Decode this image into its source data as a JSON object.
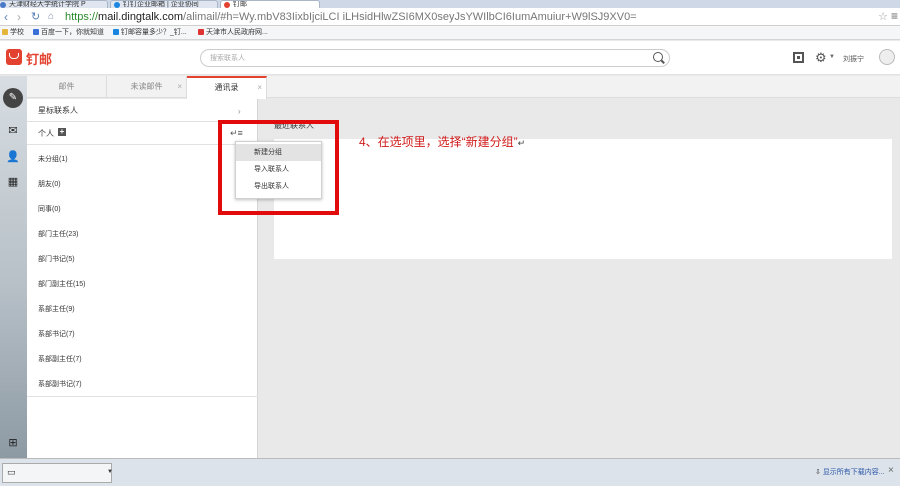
{
  "browser": {
    "tabs": [
      {
        "label": "天津财经大学统计学院 P",
        "active": false,
        "color": "#4a7ac7"
      },
      {
        "label": "钉钉企业邮箱 | 企业协同",
        "active": false,
        "color": "#1a86e0"
      },
      {
        "label": "钉邮",
        "active": true,
        "color": "#e2422f"
      }
    ],
    "url": {
      "scheme": "https://",
      "domain": "mail.dingtalk.com",
      "path": "/alimail/#h=Wy.mbV83IixbIjciLCI iLHsidHlwZSI6MX0seyJsYWIlbCI6IumAmuiur+W9lSJ9XV0="
    },
    "bookmarks": [
      {
        "label": "学校",
        "color": "#e5b63c"
      },
      {
        "label": "百度一下，你就知道",
        "color": "#3b6fd8"
      },
      {
        "label": "钉邮容量多少？_钉...",
        "color": "#1a86e0"
      },
      {
        "label": "天津市人民政府网...",
        "color": "#d33"
      }
    ]
  },
  "app": {
    "brand": "钉邮",
    "search_placeholder": "搜索联系人",
    "username": "刘振宁"
  },
  "tabs": [
    {
      "label": "邮件",
      "active": false,
      "closable": false
    },
    {
      "label": "未读邮件",
      "active": false,
      "closable": true
    },
    {
      "label": "通讯录",
      "active": true,
      "closable": true
    }
  ],
  "contacts": {
    "starred": "星标联系人",
    "personal": "个人",
    "groups": [
      "未分组(1)",
      "朋友(0)",
      "同事(0)",
      "部门主任(23)",
      "部门书记(5)",
      "部门副主任(15)",
      "系部主任(9)",
      "系部书记(7)",
      "系部副主任(7)",
      "系部副书记(7)"
    ]
  },
  "menu": {
    "items": [
      "新建分组",
      "导入联系人",
      "导出联系人"
    ],
    "highlighted_index": 0
  },
  "main": {
    "recent_title": "最近联系人"
  },
  "annotation": {
    "text": "4、在选项里，选择“新建分组”",
    "color": "#d11a1a"
  },
  "status_bar": {
    "show_all": "显示所有下载内容..."
  }
}
